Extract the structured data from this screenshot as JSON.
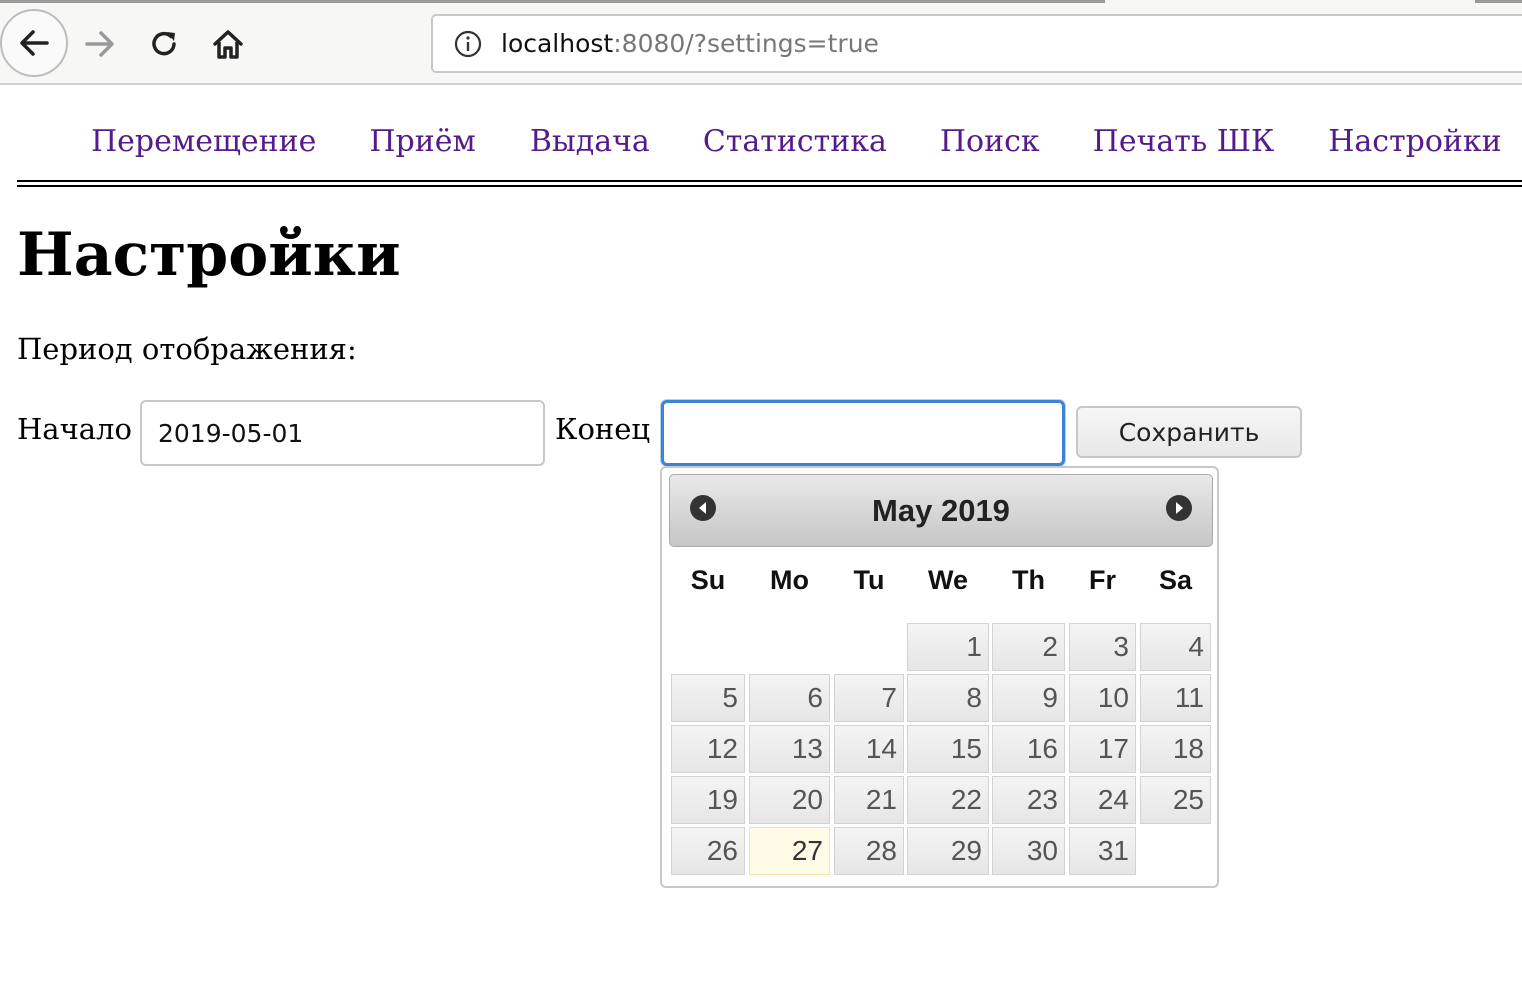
{
  "browser": {
    "url_host": "localhost",
    "url_rest": ":8080/?settings=true"
  },
  "nav": {
    "items": [
      "Перемещение",
      "Приём",
      "Выдача",
      "Статистика",
      "Поиск",
      "Печать ШК",
      "Настройки"
    ]
  },
  "page": {
    "title": "Настройки",
    "period_label": "Период отображения:",
    "start_label": "Начало",
    "start_value": "2019-05-01",
    "end_label": "Конец",
    "end_value": "",
    "save_label": "Сохранить"
  },
  "datepicker": {
    "title": "May 2019",
    "weekdays": [
      "Su",
      "Mo",
      "Tu",
      "We",
      "Th",
      "Fr",
      "Sa"
    ],
    "first_weekday_index": 3,
    "days_in_month": 31,
    "today": 27
  }
}
